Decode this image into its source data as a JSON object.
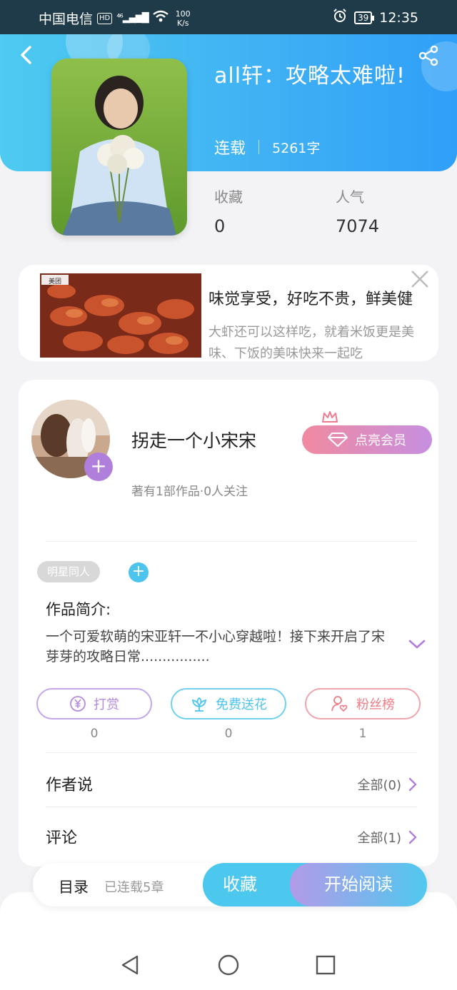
{
  "status_bar": {
    "carrier": "中国电信",
    "hd": "HD",
    "network": "⁴⁶",
    "speed_value": "100",
    "speed_unit": "K/s",
    "battery": "39",
    "time": "12:35"
  },
  "book": {
    "title": "all轩：攻略太难啦!",
    "status": "连载",
    "word_count": "5261字",
    "stats": [
      {
        "label": "收藏",
        "value": "0"
      },
      {
        "label": "人气",
        "value": "7074"
      }
    ]
  },
  "ad": {
    "brand": "美团",
    "title": "味觉享受，好吃不贵，鲜美健",
    "description_line1": "大虾还可以这样吃，就着米饭更是美",
    "description_line2": "味、下饭的美味快来一起吃"
  },
  "author": {
    "name": "拐走一个小宋宋",
    "info": "著有1部作品·0人关注",
    "follow_symbol": "+",
    "vip_label": "点亮会员"
  },
  "tags": {
    "items": [
      "明星同人"
    ],
    "add_symbol": "+"
  },
  "intro": {
    "heading": "作品简介:",
    "text": "一个可爱软萌的宋亚轩一不小心穿越啦！接下来开启了宋芽芽的攻略日常................"
  },
  "actions": [
    {
      "label": "打赏",
      "count": "0",
      "color": "#b48be0"
    },
    {
      "label": "免费送花",
      "count": "0",
      "color": "#4cc4ee"
    },
    {
      "label": "粉丝榜",
      "count": "1",
      "color": "#ee7c86"
    }
  ],
  "rows": {
    "author_says": {
      "title": "作者说",
      "more": "全部(0)"
    },
    "comments": {
      "title": "评论",
      "more": "全部(1)"
    }
  },
  "bottom_bar": {
    "toc": "目录",
    "chapters": "已连载5章",
    "collect": "收藏",
    "read": "开始阅读"
  },
  "colors": {
    "accent_blue": "#3fb0f4",
    "accent_purple": "#b07fdc",
    "vip_gradient_start": "#f08aa0",
    "vip_gradient_end": "#c78fe0"
  }
}
